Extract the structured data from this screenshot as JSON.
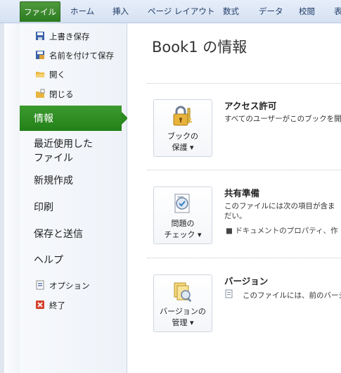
{
  "ribbon": {
    "file_tab": "ファイル",
    "tabs": [
      "ホーム",
      "挿入",
      "ページ レイアウト",
      "数式",
      "データ",
      "校閲",
      "表"
    ]
  },
  "nav": {
    "small_top": [
      {
        "label": "上書き保存",
        "icon": "save-icon"
      },
      {
        "label": "名前を付けて保存",
        "icon": "save-as-icon"
      },
      {
        "label": "開く",
        "icon": "open-folder-icon"
      },
      {
        "label": "閉じる",
        "icon": "close-folder-icon"
      }
    ],
    "selected": "情報",
    "big": [
      "最近使用した\nファイル",
      "新規作成",
      "印刷",
      "保存と送信",
      "ヘルプ"
    ],
    "recent": "最近使用した",
    "recent2": "ファイル",
    "new": "新規作成",
    "print": "印刷",
    "save_send": "保存と送信",
    "help": "ヘルプ",
    "options": "オプション",
    "exit": "終了"
  },
  "content": {
    "title": "Book1 の情報",
    "sections": [
      {
        "btn_line1": "ブックの",
        "btn_line2": "保護 ▾",
        "heading": "アクセス許可",
        "text1": "すべてのユーザーがこのブックを開",
        "text2": "",
        "text3": ""
      },
      {
        "btn_line1": "問題の",
        "btn_line2": "チェック ▾",
        "heading": "共有準備",
        "text1": "このファイルには次の項目が含ま",
        "text2": "だい。",
        "text3": "■  ドキュメントのプロパティ、作"
      },
      {
        "btn_line1": "バージョンの",
        "btn_line2": "管理 ▾",
        "heading": "バージョン",
        "text1": "このファイルには、前のバージ",
        "text2": "",
        "text3": ""
      }
    ]
  },
  "colors": {
    "file_tab": "#2b7b22",
    "selected_nav": "#2a8a1e",
    "ribbon": "#d5e1f2"
  }
}
